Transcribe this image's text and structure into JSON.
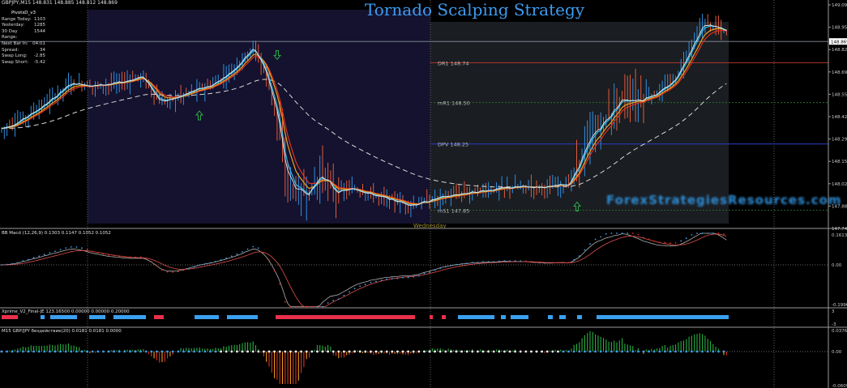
{
  "title": "Tornado Scalping Strategy",
  "symbol_line": "GBPJPY,M15  148.831 148.885 148.812 148.869",
  "watermark": "ForexStrategiesResources.com",
  "pivot_panel": {
    "header": "PivotsD_v3",
    "rows": [
      {
        "label": "Range Today:",
        "value": "1103"
      },
      {
        "label": "Yesterday:",
        "value": "1285"
      },
      {
        "label": "30 Day Range:",
        "value": "1544"
      },
      {
        "label": "Next Bar In:",
        "value": "04:01"
      },
      {
        "label": "Spread:",
        "value": "34"
      },
      {
        "label": "Swap Long:",
        "value": "-2.85"
      },
      {
        "label": "Swap Short:",
        "value": "-5.42"
      }
    ]
  },
  "pivot_levels": [
    {
      "name": "DR1",
      "value": 148.74,
      "label": "DR1  148.74",
      "color": "#c0392b"
    },
    {
      "name": "mR1",
      "value": 148.5,
      "label": "mR1  148.50",
      "color": "#2e6b2e"
    },
    {
      "name": "DPV",
      "value": 148.25,
      "label": "DPV  148.25",
      "color": "#2a3ec8"
    },
    {
      "name": "mS1",
      "value": 147.85,
      "label": "mS1  147.85",
      "color": "#2e6b2e"
    }
  ],
  "day_label": "Wednesday",
  "current_price": "148.869",
  "main_axis_ticks": [
    "149.090",
    "148.955",
    "148.820",
    "148.690",
    "148.555",
    "148.420",
    "148.290",
    "148.155",
    "148.020",
    "147.885",
    "147.745"
  ],
  "indicators": [
    {
      "name": "macd",
      "label": "BB Macd (12,26,9) 0.1303 0.1147 0.1052 0.1052",
      "ticks": [
        "0.1613",
        "0.00",
        "-0.1996"
      ]
    },
    {
      "name": "xprime",
      "label": "Xprime_V2_Final-JE 123.16500 0.00000 0.00000 0.20000",
      "ticks": [
        "3",
        "-3"
      ]
    },
    {
      "name": "histogram",
      "label": "M15 GBP/JPY бездействие(20) 0.0181 0.0181 0.0000",
      "ticks": [
        "0.0376",
        "0.00",
        "-0.0609"
      ]
    }
  ],
  "colors": {
    "bg": "#000000",
    "session_prev": "#14122e",
    "session_curr": "#1a1d22",
    "bull": "#2f8fe0",
    "bear": "#e25a3a",
    "ema_fast": "#e8e8e8",
    "ema_cyan": "#30c6f0",
    "ema_orange": "#f0a020",
    "ema_red": "#e03020",
    "ma_slow": "#d8d8d8",
    "up_arrow": "#2ea84a",
    "xprime_red": "#e8304a",
    "xprime_blue": "#3aa0f0",
    "hist_green": "#28b040",
    "hist_red": "#e03020",
    "hist_orange": "#e8a020"
  },
  "chart_data": {
    "type": "line",
    "series": [],
    "x": [],
    "ylim": [
      147.745,
      149.09
    ],
    "grid": false
  }
}
